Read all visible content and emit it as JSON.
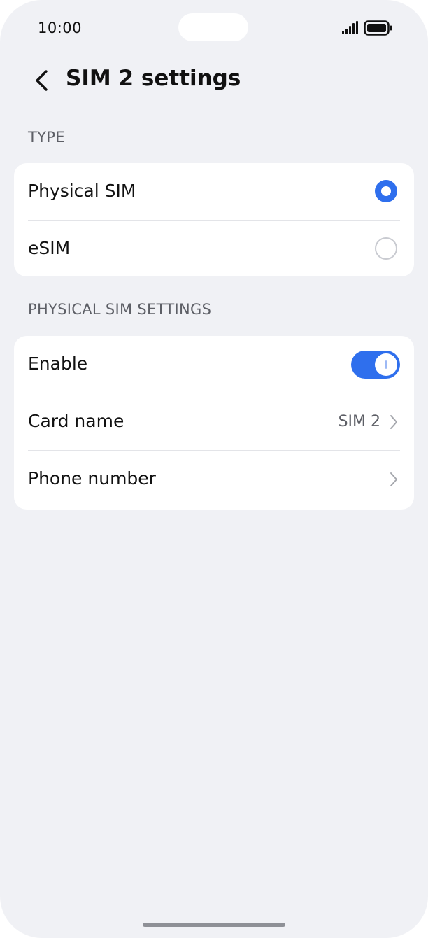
{
  "status_bar": {
    "time": "10:00",
    "signal_icon": "cellular-signal-icon",
    "battery_icon": "battery-full-icon"
  },
  "header": {
    "back_icon": "chevron-left-icon",
    "title": "SIM 2 settings"
  },
  "type_section": {
    "label": "TYPE",
    "options": [
      {
        "label": "Physical SIM",
        "selected": true
      },
      {
        "label": "eSIM",
        "selected": false
      }
    ]
  },
  "physical_sim_section": {
    "label": "PHYSICAL SIM SETTINGS",
    "enable": {
      "label": "Enable",
      "on": true
    },
    "card_name": {
      "label": "Card name",
      "value": "SIM 2"
    },
    "phone_number": {
      "label": "Phone number"
    }
  },
  "colors": {
    "accent": "#2f6fed",
    "background": "#f0f1f5",
    "card": "#ffffff",
    "secondary_text": "#5d5f66"
  }
}
